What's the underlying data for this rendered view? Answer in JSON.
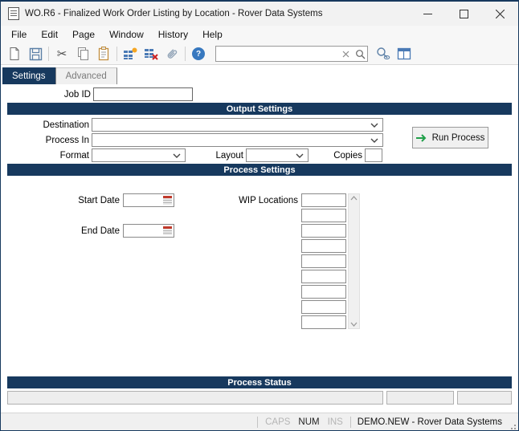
{
  "window": {
    "title": "WO.R6 - Finalized Work Order Listing by Location - Rover Data Systems"
  },
  "menu": {
    "items": [
      "File",
      "Edit",
      "Page",
      "Window",
      "History",
      "Help"
    ]
  },
  "toolbar": {
    "icon_names": [
      "new-icon",
      "save-icon",
      "cut-icon",
      "copy-icon",
      "paste-icon",
      "insert-rows-icon",
      "delete-rows-icon",
      "attachment-icon",
      "help-icon",
      "search-clear-icon",
      "search-icon",
      "view-results-icon",
      "form-layout-icon"
    ],
    "search": {
      "value": "",
      "placeholder": ""
    }
  },
  "icons": {
    "cut_glyph": "✂",
    "help_glyph": "?"
  },
  "tabs": [
    {
      "label": "Settings",
      "active": true
    },
    {
      "label": "Advanced",
      "active": false
    }
  ],
  "form": {
    "job_id": {
      "label": "Job ID",
      "value": ""
    },
    "output_settings": {
      "header": "Output Settings",
      "destination_label": "Destination",
      "destination_value": "",
      "process_in_label": "Process In",
      "process_in_value": "",
      "format_label": "Format",
      "format_value": "",
      "layout_label": "Layout",
      "layout_value": "",
      "copies_label": "Copies",
      "copies_value": "",
      "run_button_label": "Run Process"
    },
    "process_settings": {
      "header": "Process Settings",
      "start_date_label": "Start Date",
      "start_date_value": "",
      "end_date_label": "End Date",
      "end_date_value": "",
      "wip_locations_label": "WIP Locations",
      "wip_rows": 9,
      "wip_values": [
        "",
        "",
        "",
        "",
        "",
        "",
        "",
        "",
        ""
      ]
    },
    "process_status": {
      "header": "Process Status"
    }
  },
  "status_bar": {
    "caps": "CAPS",
    "num": "NUM",
    "ins": "INS",
    "connection": "DEMO.NEW - Rover Data Systems"
  },
  "colors": {
    "navy": "#17395e",
    "toolbar_blue": "#4a7ab5",
    "steel_blue": "#5b7fa6",
    "green": "#21a04a",
    "red": "#c0392b",
    "help_blue": "#3778bf"
  }
}
